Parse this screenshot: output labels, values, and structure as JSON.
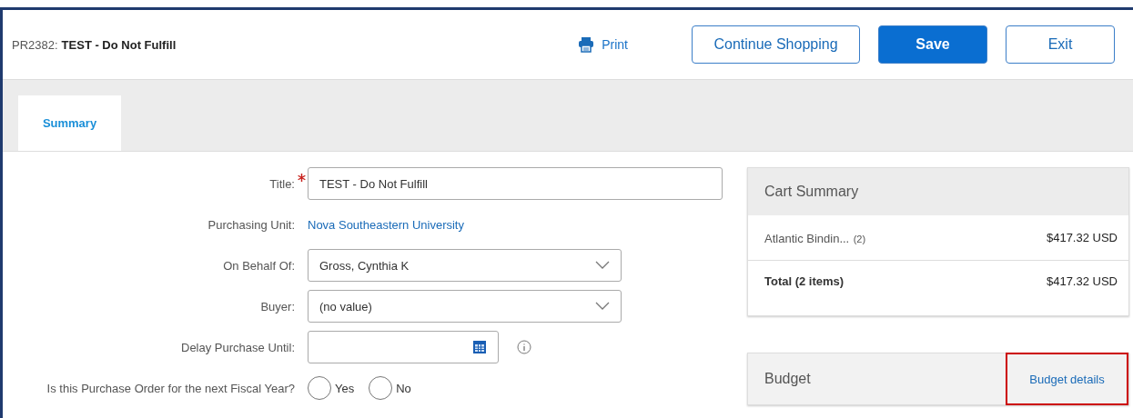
{
  "header": {
    "id": "PR2382:",
    "title": "TEST - Do Not Fulfill",
    "print": "Print",
    "buttons": [
      {
        "label": "Continue Shopping",
        "kind": "secondary"
      },
      {
        "label": "Save",
        "kind": "primary"
      },
      {
        "label": "Exit",
        "kind": "secondary"
      }
    ]
  },
  "tabs": [
    {
      "label": "Summary",
      "selected": true
    }
  ],
  "form": [
    {
      "kind": "text",
      "label": "Title:",
      "required": true,
      "value": "TEST - Do Not Fulfill"
    },
    {
      "kind": "link",
      "label": "Purchasing Unit:",
      "value": "Nova Southeastern University"
    },
    {
      "kind": "select",
      "label": "On Behalf Of:",
      "value": "Gross, Cynthia K"
    },
    {
      "kind": "select",
      "label": "Buyer:",
      "value": "(no value)"
    },
    {
      "kind": "date",
      "label": "Delay Purchase Until:"
    },
    {
      "kind": "radio",
      "label": "Is this Purchase Order for the next Fiscal Year?",
      "options": [
        {
          "label": "Yes",
          "selected": false
        },
        {
          "label": "No",
          "selected": false
        }
      ]
    }
  ],
  "cart_summary": {
    "title": "Cart Summary",
    "items": [
      {
        "name": "Atlantic Bindin...",
        "count": "(2)",
        "price": "$417.32 USD"
      }
    ],
    "total": {
      "label": "Total (2 items)",
      "price": "$417.32 USD"
    }
  },
  "budget": {
    "title": "Budget",
    "link": "Budget details",
    "highlighted": true
  }
}
